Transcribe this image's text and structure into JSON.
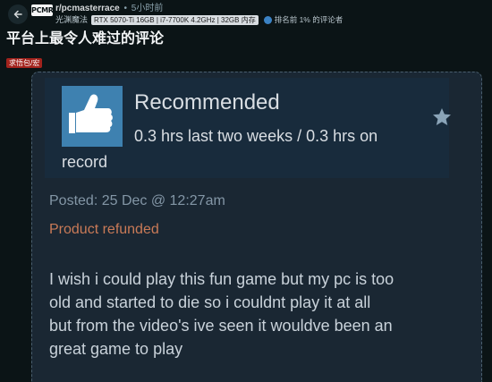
{
  "post_header": {
    "subreddit_badge": "PCMR",
    "subreddit": "r/pcmasterrace",
    "separator": "•",
    "time": "5小时前",
    "username": "光渊魔法",
    "flair": "RTX 5070-Ti 16GB | i7-7700K 4.2GHz | 32GB 内存",
    "rank_text": "排名前 1% 的评论者"
  },
  "post": {
    "title": "平台上最令人难过的评论",
    "tag": "求悟包/宏"
  },
  "review_card": {
    "recommendation": "Recommended",
    "hours_line1": "0.3 hrs last two weeks / 0.3 hrs on",
    "hours_line2": "record",
    "posted": "Posted: 25 Dec @ 12:27am",
    "status": "Product refunded",
    "review_lines": [
      "I wish i could play this fun game but my pc is too",
      "old and started to die so i couldnt play it at all",
      "but from the video's ive seen it wouldve been an",
      "great game to play"
    ]
  },
  "colors": {
    "background": "#0b1416",
    "card": "#1a2733",
    "thumb_blue": "#3e81b0",
    "refund_orange": "#c97a57",
    "tag_red": "#a2231d"
  },
  "icons": [
    "back-arrow-icon",
    "thumbs-up-icon",
    "star-icon",
    "rank-icon"
  ]
}
